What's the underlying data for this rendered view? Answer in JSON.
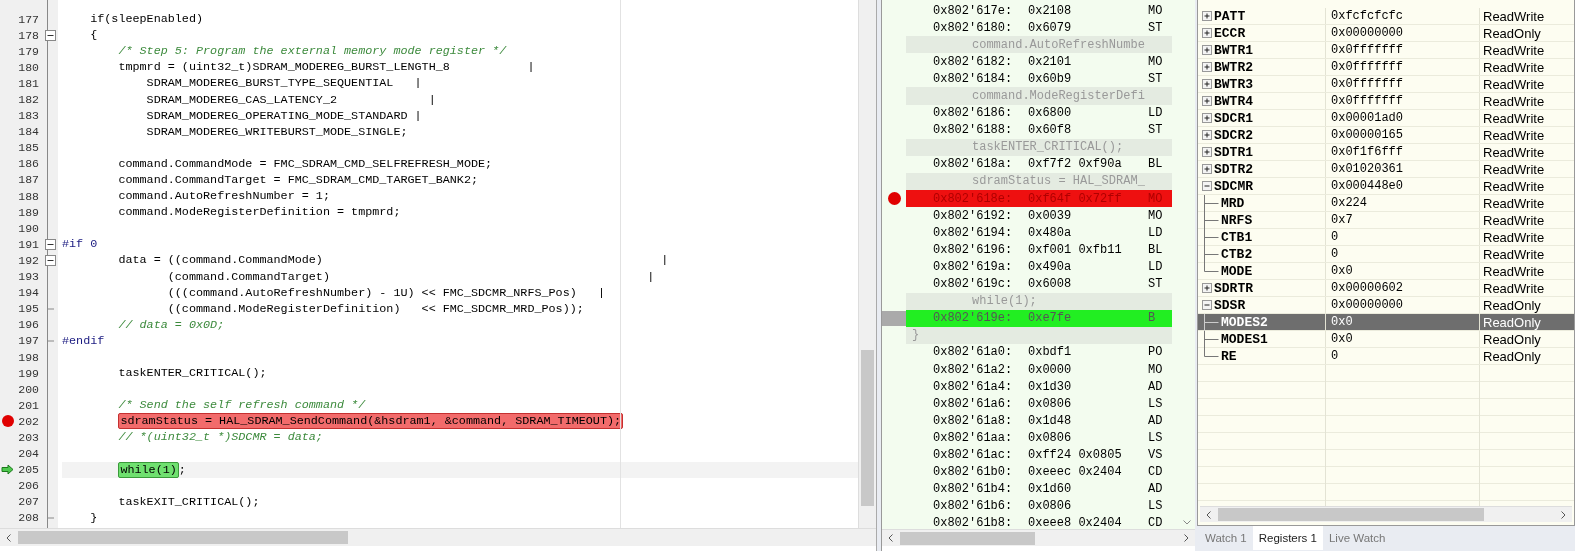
{
  "editor": {
    "lines": [
      {
        "number": "177",
        "text": "    if(sleepEnabled)",
        "kind": "code"
      },
      {
        "number": "178",
        "text": "    {",
        "kind": "code",
        "collapsible": true
      },
      {
        "number": "179",
        "text": "        /* Step 5: Program the external memory mode register */",
        "kind": "comment"
      },
      {
        "number": "180",
        "text": "        tmpmrd = (uint32_t)SDRAM_MODEREG_BURST_LENGTH_8           |",
        "kind": "code"
      },
      {
        "number": "181",
        "text": "            SDRAM_MODEREG_BURST_TYPE_SEQUENTIAL   |",
        "kind": "code"
      },
      {
        "number": "182",
        "text": "            SDRAM_MODEREG_CAS_LATENCY_2             |",
        "kind": "code"
      },
      {
        "number": "183",
        "text": "            SDRAM_MODEREG_OPERATING_MODE_STANDARD |",
        "kind": "code"
      },
      {
        "number": "184",
        "text": "            SDRAM_MODEREG_WRITEBURST_MODE_SINGLE;",
        "kind": "code"
      },
      {
        "number": "185"
      },
      {
        "number": "186",
        "text": "        command.CommandMode = FMC_SDRAM_CMD_SELFREFRESH_MODE;",
        "kind": "code"
      },
      {
        "number": "187",
        "text": "        command.CommandTarget = FMC_SDRAM_CMD_TARGET_BANK2;",
        "kind": "code"
      },
      {
        "number": "188",
        "text": "        command.AutoRefreshNumber = 1;",
        "kind": "code"
      },
      {
        "number": "189",
        "text": "        command.ModeRegisterDefinition = tmpmrd;",
        "kind": "code"
      },
      {
        "number": "190"
      },
      {
        "number": "191",
        "text": "#if 0",
        "kind": "directive",
        "collapsible": true
      },
      {
        "number": "192",
        "text": "        data = ((command.CommandMode)                                                |",
        "kind": "code",
        "collapsible": true
      },
      {
        "number": "193",
        "text": "               (command.CommandTarget)                                             |",
        "kind": "code"
      },
      {
        "number": "194",
        "text": "               (((command.AutoRefreshNumber) - 1U) << FMC_SDCMR_NRFS_Pos)   |",
        "kind": "code"
      },
      {
        "number": "195",
        "text": "               ((command.ModeRegisterDefinition)   << FMC_SDCMR_MRD_Pos));",
        "kind": "code",
        "block_end": true
      },
      {
        "number": "196",
        "text": "        // data = 0x0D;",
        "kind": "comment"
      },
      {
        "number": "197",
        "text": "#endif",
        "kind": "directive",
        "block_end": true
      },
      {
        "number": "198"
      },
      {
        "number": "199",
        "text": "        taskENTER_CRITICAL();",
        "kind": "code"
      },
      {
        "number": "200"
      },
      {
        "number": "201",
        "text": "        /* Send the self refresh command */",
        "kind": "comment"
      },
      {
        "number": "202",
        "marked": "sdramStatus = HAL_SDRAM_SendCommand(&hsdram1, &command, SDRAM_TIMEOUT);",
        "kind": "code",
        "breakpoint": true
      },
      {
        "number": "203",
        "text": "        // *(uint32_t *)SDCMR = data;",
        "kind": "comment"
      },
      {
        "number": "204"
      },
      {
        "number": "205",
        "marked": "while(1)",
        "tail": ";",
        "kind": "code",
        "current": true
      },
      {
        "number": "206"
      },
      {
        "number": "207",
        "text": "        taskEXIT_CRITICAL();",
        "kind": "code"
      },
      {
        "number": "208",
        "text": "    }",
        "kind": "code",
        "block_end": true
      }
    ]
  },
  "disassembly": {
    "rows": [
      {
        "kind": "instr",
        "address": "0x802'617e:",
        "bytes": "0x2108",
        "mnemonic": "MO"
      },
      {
        "kind": "instr",
        "address": "0x802'6180:",
        "bytes": "0x6079",
        "mnemonic": "ST"
      },
      {
        "kind": "source",
        "text": "command.AutoRefreshNumbe"
      },
      {
        "kind": "instr",
        "address": "0x802'6182:",
        "bytes": "0x2101",
        "mnemonic": "MO"
      },
      {
        "kind": "instr",
        "address": "0x802'6184:",
        "bytes": "0x60b9",
        "mnemonic": "ST"
      },
      {
        "kind": "source",
        "text": "command.ModeRegisterDefi"
      },
      {
        "kind": "instr",
        "address": "0x802'6186:",
        "bytes": "0x6800",
        "mnemonic": "LD"
      },
      {
        "kind": "instr",
        "address": "0x802'6188:",
        "bytes": "0x60f8",
        "mnemonic": "ST"
      },
      {
        "kind": "source",
        "text": "taskENTER_CRITICAL();"
      },
      {
        "kind": "instr",
        "address": "0x802'618a:",
        "bytes": "0xf7f2 0xf90a",
        "mnemonic": "BL"
      },
      {
        "kind": "source",
        "text": "sdramStatus = HAL_SDRAM_"
      },
      {
        "kind": "instr",
        "address": "0x802'618e:",
        "bytes": "0xf64f 0x72ff",
        "mnemonic": "MO",
        "breakpoint": true
      },
      {
        "kind": "instr",
        "address": "0x802'6192:",
        "bytes": "0x0039",
        "mnemonic": "MO"
      },
      {
        "kind": "instr",
        "address": "0x802'6194:",
        "bytes": "0x480a",
        "mnemonic": "LD"
      },
      {
        "kind": "instr",
        "address": "0x802'6196:",
        "bytes": "0xf001 0xfb11",
        "mnemonic": "BL"
      },
      {
        "kind": "instr",
        "address": "0x802'619a:",
        "bytes": "0x490a",
        "mnemonic": "LD"
      },
      {
        "kind": "instr",
        "address": "0x802'619c:",
        "bytes": "0x6008",
        "mnemonic": "ST"
      },
      {
        "kind": "source",
        "text": "while(1);"
      },
      {
        "kind": "instr",
        "address": "0x802'619e:",
        "bytes": "0xe7fe",
        "mnemonic": "B",
        "current": true
      },
      {
        "kind": "brace",
        "text": "}"
      },
      {
        "kind": "instr",
        "address": "0x802'61a0:",
        "bytes": "0xbdf1",
        "mnemonic": "PO"
      },
      {
        "kind": "instr",
        "address": "0x802'61a2:",
        "bytes": "0x0000",
        "mnemonic": "MO"
      },
      {
        "kind": "instr",
        "address": "0x802'61a4:",
        "bytes": "0x1d30",
        "mnemonic": "AD"
      },
      {
        "kind": "instr",
        "address": "0x802'61a6:",
        "bytes": "0x0806",
        "mnemonic": "LS"
      },
      {
        "kind": "instr",
        "address": "0x802'61a8:",
        "bytes": "0x1d48",
        "mnemonic": "AD"
      },
      {
        "kind": "instr",
        "address": "0x802'61aa:",
        "bytes": "0x0806",
        "mnemonic": "LS"
      },
      {
        "kind": "instr",
        "address": "0x802'61ac:",
        "bytes": "0xff24 0x0805",
        "mnemonic": "VS"
      },
      {
        "kind": "instr",
        "address": "0x802'61b0:",
        "bytes": "0xeeec 0x2404",
        "mnemonic": "CD"
      },
      {
        "kind": "instr",
        "address": "0x802'61b4:",
        "bytes": "0x1d60",
        "mnemonic": "AD"
      },
      {
        "kind": "instr",
        "address": "0x802'61b6:",
        "bytes": "0x0806",
        "mnemonic": "LS"
      },
      {
        "kind": "instr",
        "address": "0x802'61b8:",
        "bytes": "0xeee8 0x2404",
        "mnemonic": "CD"
      }
    ]
  },
  "registers": {
    "rows": [
      {
        "name": "PATT",
        "value": "0xfcfcfcfc",
        "access": "ReadWrite",
        "expanded": false,
        "selected": false
      },
      {
        "name": "ECCR",
        "value": "0x00000000",
        "access": "ReadOnly",
        "expanded": false,
        "selected": false
      },
      {
        "name": "BWTR1",
        "value": "0x0fffffff",
        "access": "ReadWrite",
        "expanded": false,
        "selected": false
      },
      {
        "name": "BWTR2",
        "value": "0x0fffffff",
        "access": "ReadWrite",
        "expanded": false,
        "selected": false
      },
      {
        "name": "BWTR3",
        "value": "0x0fffffff",
        "access": "ReadWrite",
        "expanded": false,
        "selected": false
      },
      {
        "name": "BWTR4",
        "value": "0x0fffffff",
        "access": "ReadWrite",
        "expanded": false,
        "selected": false
      },
      {
        "name": "SDCR1",
        "value": "0x00001ad0",
        "access": "ReadWrite",
        "expanded": false,
        "selected": false
      },
      {
        "name": "SDCR2",
        "value": "0x00000165",
        "access": "ReadWrite",
        "expanded": false,
        "selected": false
      },
      {
        "name": "SDTR1",
        "value": "0x0f1f6fff",
        "access": "ReadWrite",
        "expanded": false,
        "selected": false
      },
      {
        "name": "SDTR2",
        "value": "0x01020361",
        "access": "ReadWrite",
        "expanded": false,
        "selected": false
      },
      {
        "name": "SDCMR",
        "value": "0x000448e0",
        "access": "ReadWrite",
        "expanded": true,
        "selected": false,
        "children": [
          {
            "name": "MRD",
            "value": "0x224",
            "access": "ReadWrite",
            "selected": false
          },
          {
            "name": "NRFS",
            "value": "0x7",
            "access": "ReadWrite",
            "selected": false
          },
          {
            "name": "CTB1",
            "value": "0",
            "access": "ReadWrite",
            "selected": false
          },
          {
            "name": "CTB2",
            "value": "0",
            "access": "ReadWrite",
            "selected": false
          },
          {
            "name": "MODE",
            "value": "0x0",
            "access": "ReadWrite",
            "selected": false
          }
        ]
      },
      {
        "name": "SDRTR",
        "value": "0x00000602",
        "access": "ReadWrite",
        "expanded": false,
        "selected": false
      },
      {
        "name": "SDSR",
        "value": "0x00000000",
        "access": "ReadOnly",
        "expanded": true,
        "selected": false,
        "children": [
          {
            "name": "MODES2",
            "value": "0x0",
            "access": "ReadOnly",
            "selected": true
          },
          {
            "name": "MODES1",
            "value": "0x0",
            "access": "ReadOnly",
            "selected": false
          },
          {
            "name": "RE",
            "value": "0",
            "access": "ReadOnly",
            "selected": false
          }
        ]
      }
    ],
    "tabs": [
      {
        "label": "Watch 1",
        "selected": false
      },
      {
        "label": "Registers 1",
        "selected": true
      },
      {
        "label": "Live Watch",
        "selected": false
      }
    ]
  }
}
